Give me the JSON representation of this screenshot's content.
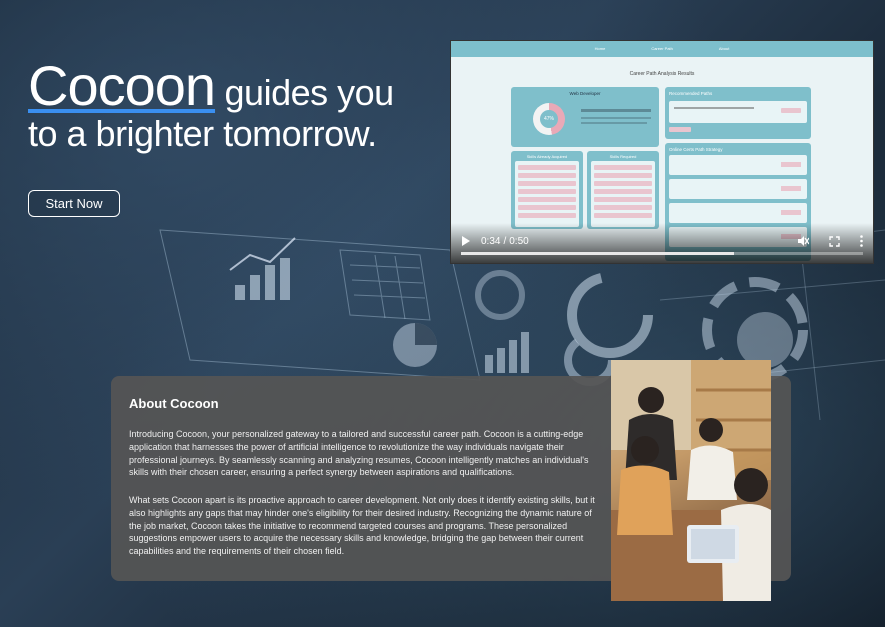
{
  "hero": {
    "brand": "Cocoon",
    "line1_rest": " guides you",
    "line2": "to a brighter tomorrow.",
    "cta_label": "Start Now",
    "accent_color": "#3a8ff0"
  },
  "video": {
    "nav_items": [
      "Home",
      "Career Path",
      "About"
    ],
    "page_title": "Career Path Analysis Results",
    "panel_titles": {
      "career": "Web Developer",
      "recommended": "Recommended Paths",
      "skills_present": "Skills Already Acquired",
      "skills_missing": "Skills Required",
      "courses": "Online Certs Path Strategy"
    },
    "match_percent": "47%",
    "time_current": "0:34",
    "time_total": "0:50",
    "progress": 0.68,
    "controls": [
      "play-icon",
      "mute-icon",
      "fullscreen-icon",
      "more-icon"
    ]
  },
  "about": {
    "heading": "About Cocoon",
    "paragraph1": "Introducing Cocoon, your personalized gateway to a tailored and successful career path. Cocoon is a cutting-edge application that harnesses the power of artificial intelligence to revolutionize the way individuals navigate their professional journeys. By seamlessly scanning and analyzing resumes, Cocoon intelligently matches an individual's skills with their chosen career, ensuring a perfect synergy between aspirations and qualifications.",
    "paragraph2": "What sets Cocoon apart is its proactive approach to career development. Not only does it identify existing skills, but it also highlights any gaps that may hinder one's eligibility for their desired industry. Recognizing the dynamic nature of the job market, Cocoon takes the initiative to recommend targeted courses and programs. These personalized suggestions empower users to acquire the necessary skills and knowledge, bridging the gap between their current capabilities and the requirements of their chosen field."
  }
}
